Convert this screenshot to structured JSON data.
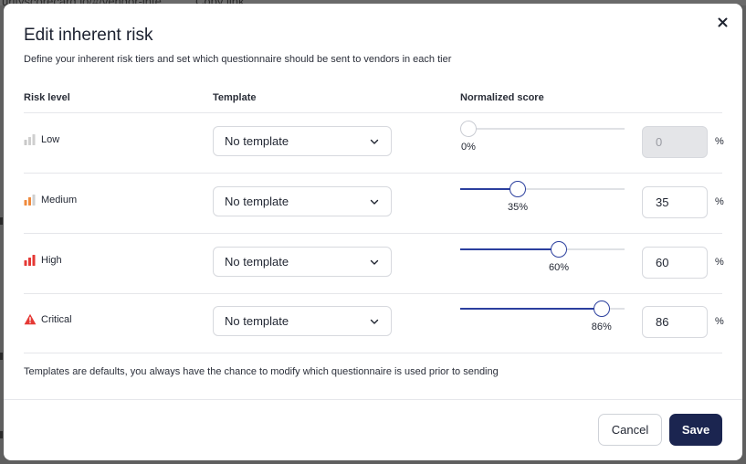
{
  "background": {
    "peek_text": "urityscorecard.io/#/vendor-inte",
    "peek_link": "Copy link"
  },
  "modal": {
    "title": "Edit inherent risk",
    "subtitle": "Define your inherent risk tiers and set which questionnaire should be sent to vendors in each tier",
    "close_icon": "close-icon"
  },
  "table": {
    "headers": {
      "risk_level": "Risk level",
      "template": "Template",
      "normalized_score": "Normalized score"
    },
    "unit": "%",
    "rows": [
      {
        "label": "Low",
        "icon": "signal-low-icon",
        "icon_color": "#c9c9c9",
        "template": "No template",
        "score": 0,
        "score_label": "0%",
        "input_value": "0",
        "disabled": true
      },
      {
        "label": "Medium",
        "icon": "signal-medium-icon",
        "icon_color": "#f08a3c",
        "template": "No template",
        "score": 35,
        "score_label": "35%",
        "input_value": "35",
        "disabled": false
      },
      {
        "label": "High",
        "icon": "signal-high-icon",
        "icon_color": "#e53935",
        "template": "No template",
        "score": 60,
        "score_label": "60%",
        "input_value": "60",
        "disabled": false
      },
      {
        "label": "Critical",
        "icon": "warning-triangle-icon",
        "icon_color": "#e53935",
        "template": "No template",
        "score": 86,
        "score_label": "86%",
        "input_value": "86",
        "disabled": false
      }
    ]
  },
  "footnote": "Templates are defaults, you always have the chance to modify which questionnaire is used prior to sending",
  "buttons": {
    "cancel": "Cancel",
    "save": "Save"
  },
  "colors": {
    "accent": "#2b3f9e",
    "primary_button": "#1b2550"
  }
}
